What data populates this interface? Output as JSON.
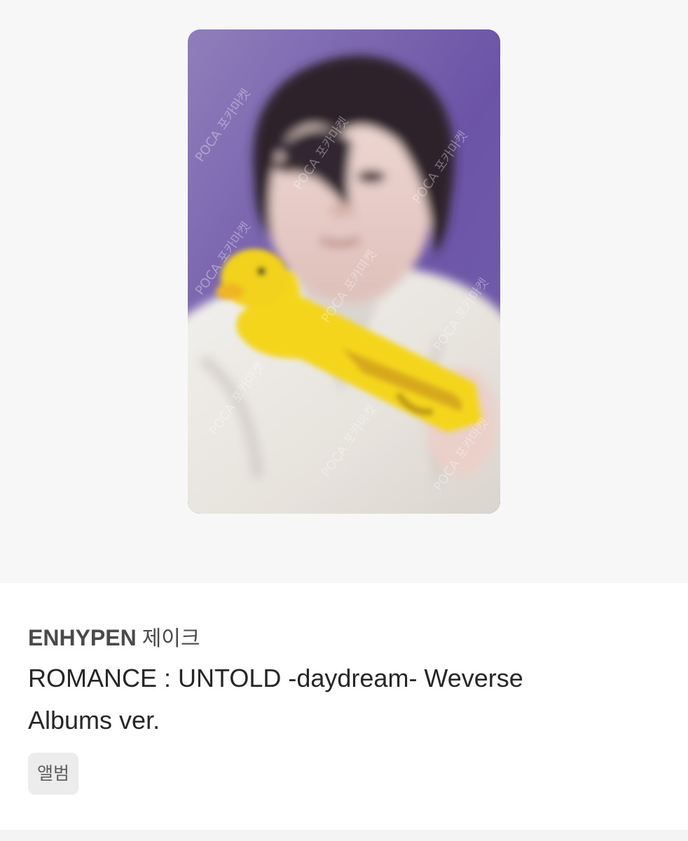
{
  "listing": {
    "artist": "ENHYPEN",
    "member": "제이크",
    "album_line_1": "ROMANCE : UNTOLD -daydream- Weverse",
    "album_line_2": "Albums ver.",
    "tag": "앨범"
  },
  "photocard": {
    "watermark_text": "POCA 포카마켓",
    "background_color": "#8b78b6",
    "duck_color": "#f4d51f"
  },
  "colors": {
    "page_top_background": "#f7f7f8",
    "page_bottom_background": "#ffffff",
    "tag_background": "#ececec",
    "text_primary": "#262626",
    "text_secondary": "#4a4a4a"
  }
}
